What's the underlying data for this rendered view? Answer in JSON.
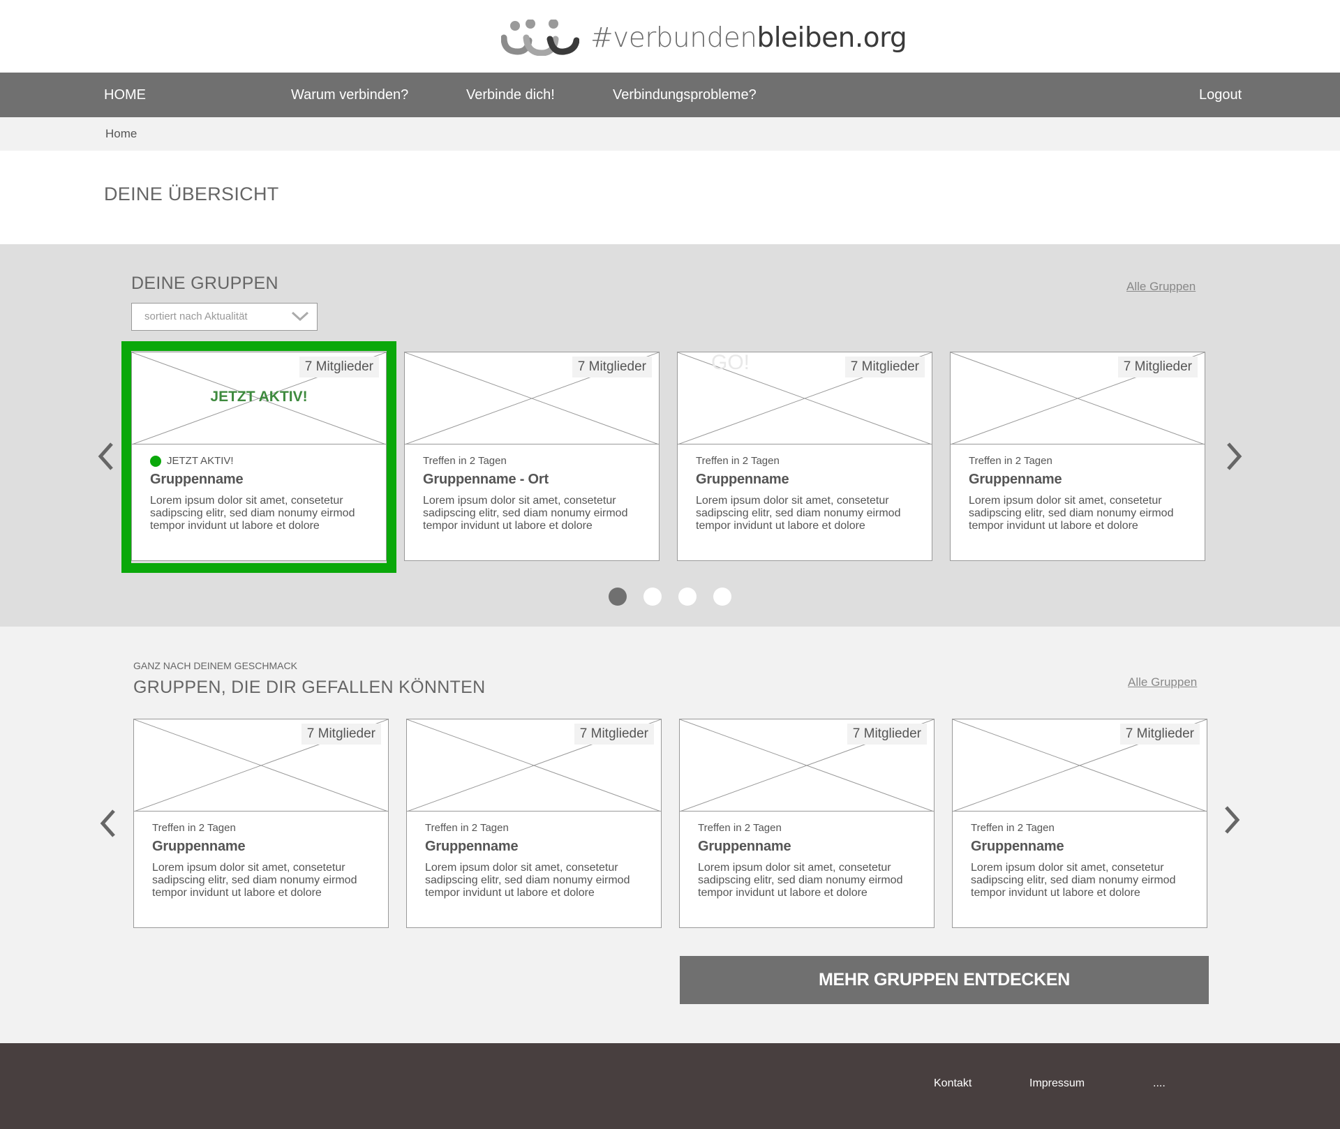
{
  "header": {
    "logo_text_light": "#verbunden",
    "logo_text_dark": "bleiben.org"
  },
  "nav": {
    "home": "HOME",
    "why": "Warum verbinden?",
    "connect": "Verbinde dich!",
    "problems": "Verbindungsprobleme?",
    "logout": "Logout"
  },
  "breadcrumb": {
    "home": "Home"
  },
  "page_title": "DEINE ÜBERSICHT",
  "my_groups": {
    "title": "DEINE GRUPPEN",
    "all_link": "Alle Gruppen",
    "sort_value": "sortiert nach Aktualität",
    "active_overlay": "JETZT AKTIV!",
    "go_overlay": "GO!",
    "cards": [
      {
        "members": "7 Mitglieder",
        "meta": "JETZT AKTIV!",
        "name": "Gruppenname",
        "desc": "Lorem ipsum dolor sit amet, consetetur sadipscing elitr, sed diam nonumy eirmod tempor invidunt ut labore et dolore"
      },
      {
        "members": "7 Mitglieder",
        "meta": "Treffen in 2 Tagen",
        "name": "Gruppenname - Ort",
        "desc": "Lorem ipsum dolor sit amet, consetetur sadipscing elitr, sed diam nonumy eirmod tempor invidunt ut labore et dolore"
      },
      {
        "members": "7 Mitglieder",
        "meta": "Treffen in 2 Tagen",
        "name": "Gruppenname",
        "desc": "Lorem ipsum dolor sit amet, consetetur sadipscing elitr, sed diam nonumy eirmod tempor invidunt ut labore et dolore"
      },
      {
        "members": "7 Mitglieder",
        "meta": "Treffen in 2 Tagen",
        "name": "Gruppenname",
        "desc": "Lorem ipsum dolor sit amet, consetetur sadipscing elitr, sed diam nonumy eirmod tempor invidunt ut labore et dolore"
      }
    ]
  },
  "recommended": {
    "subtitle": "GANZ NACH DEINEM GESCHMACK",
    "title": "GRUPPEN, DIE DIR GEFALLEN KÖNNTEN",
    "all_link": "Alle Gruppen",
    "cards": [
      {
        "members": "7 Mitglieder",
        "meta": "Treffen in 2 Tagen",
        "name": "Gruppenname",
        "desc": "Lorem ipsum dolor sit amet, consetetur sadipscing elitr, sed diam nonumy eirmod tempor invidunt ut labore et dolore"
      },
      {
        "members": "7 Mitglieder",
        "meta": "Treffen in 2 Tagen",
        "name": "Gruppenname",
        "desc": "Lorem ipsum dolor sit amet, consetetur sadipscing elitr, sed diam nonumy eirmod tempor invidunt ut labore et dolore"
      },
      {
        "members": "7 Mitglieder",
        "meta": "Treffen in 2 Tagen",
        "name": "Gruppenname",
        "desc": "Lorem ipsum dolor sit amet, consetetur sadipscing elitr, sed diam nonumy eirmod tempor invidunt ut labore et dolore"
      },
      {
        "members": "7 Mitglieder",
        "meta": "Treffen in 2 Tagen",
        "name": "Gruppenname",
        "desc": "Lorem ipsum dolor sit amet, consetetur sadipscing elitr, sed diam nonumy eirmod tempor invidunt ut labore et dolore"
      }
    ],
    "more_button": "MEHR GRUPPEN ENTDECKEN"
  },
  "pager": {
    "pages": 4,
    "active_index": 0
  },
  "footer": {
    "contact": "Kontakt",
    "imprint": "Impressum",
    "more": "...."
  },
  "colors": {
    "nav_bg": "#707070",
    "active_green": "#0aa80a",
    "footer_bg": "#483f3f",
    "groups_bg": "#dedede",
    "recommended_bg": "#f2f2f2"
  },
  "icons": {
    "logo": "people-logo-icon",
    "arrow_left": "chevron-left-icon",
    "arrow_right": "chevron-right-icon",
    "select": "chevron-down-icon"
  }
}
